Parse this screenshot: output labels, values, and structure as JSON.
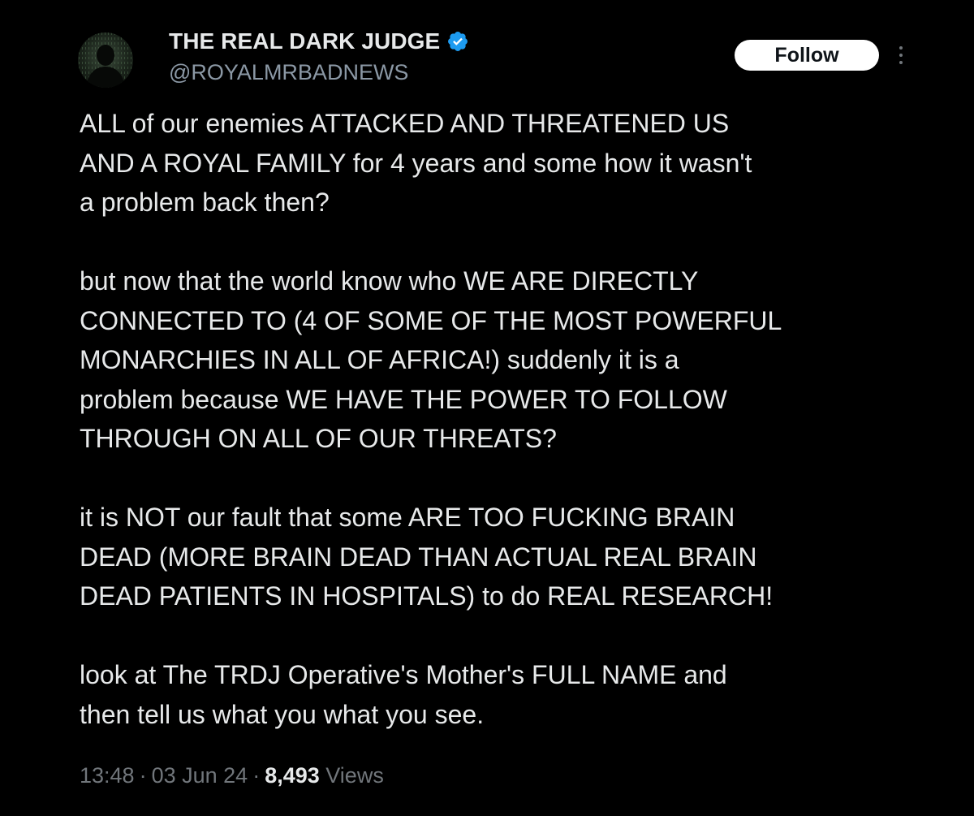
{
  "author": {
    "display_name": "THE REAL DARK JUDGE",
    "handle": "@ROYALMRBADNEWS",
    "verified": true,
    "verified_color": "#1d9bf0",
    "avatar_icon": "avatar-silhouette-icon"
  },
  "actions": {
    "follow_label": "Follow",
    "more_icon": "more-vertical-icon"
  },
  "tweet": {
    "paragraphs": [
      "ALL of our enemies ATTACKED AND THREATENED US\nAND A ROYAL FAMILY for 4 years and some how it wasn't\na problem back then?",
      "but now that the world know who WE ARE DIRECTLY\nCONNECTED TO (4 OF SOME OF THE MOST POWERFUL\nMONARCHIES IN ALL OF AFRICA!) suddenly it is a\nproblem because WE HAVE THE POWER TO FOLLOW\nTHROUGH ON ALL OF OUR THREATS?",
      "it is NOT our fault that some ARE TOO FUCKING BRAIN\nDEAD (MORE BRAIN DEAD THAN ACTUAL REAL BRAIN\nDEAD PATIENTS IN HOSPITALS) to do REAL RESEARCH!",
      "look at The TRDJ Operative's Mother's FULL NAME and\nthen tell us what you what you see."
    ]
  },
  "meta": {
    "time": "13:48",
    "separator": "·",
    "date": "03 Jun 24",
    "views_count": "8,493",
    "views_label": "Views"
  },
  "colors": {
    "background": "#000000",
    "text_primary": "#e7e9ea",
    "text_secondary": "#71767b",
    "follow_bg": "#ffffff"
  }
}
